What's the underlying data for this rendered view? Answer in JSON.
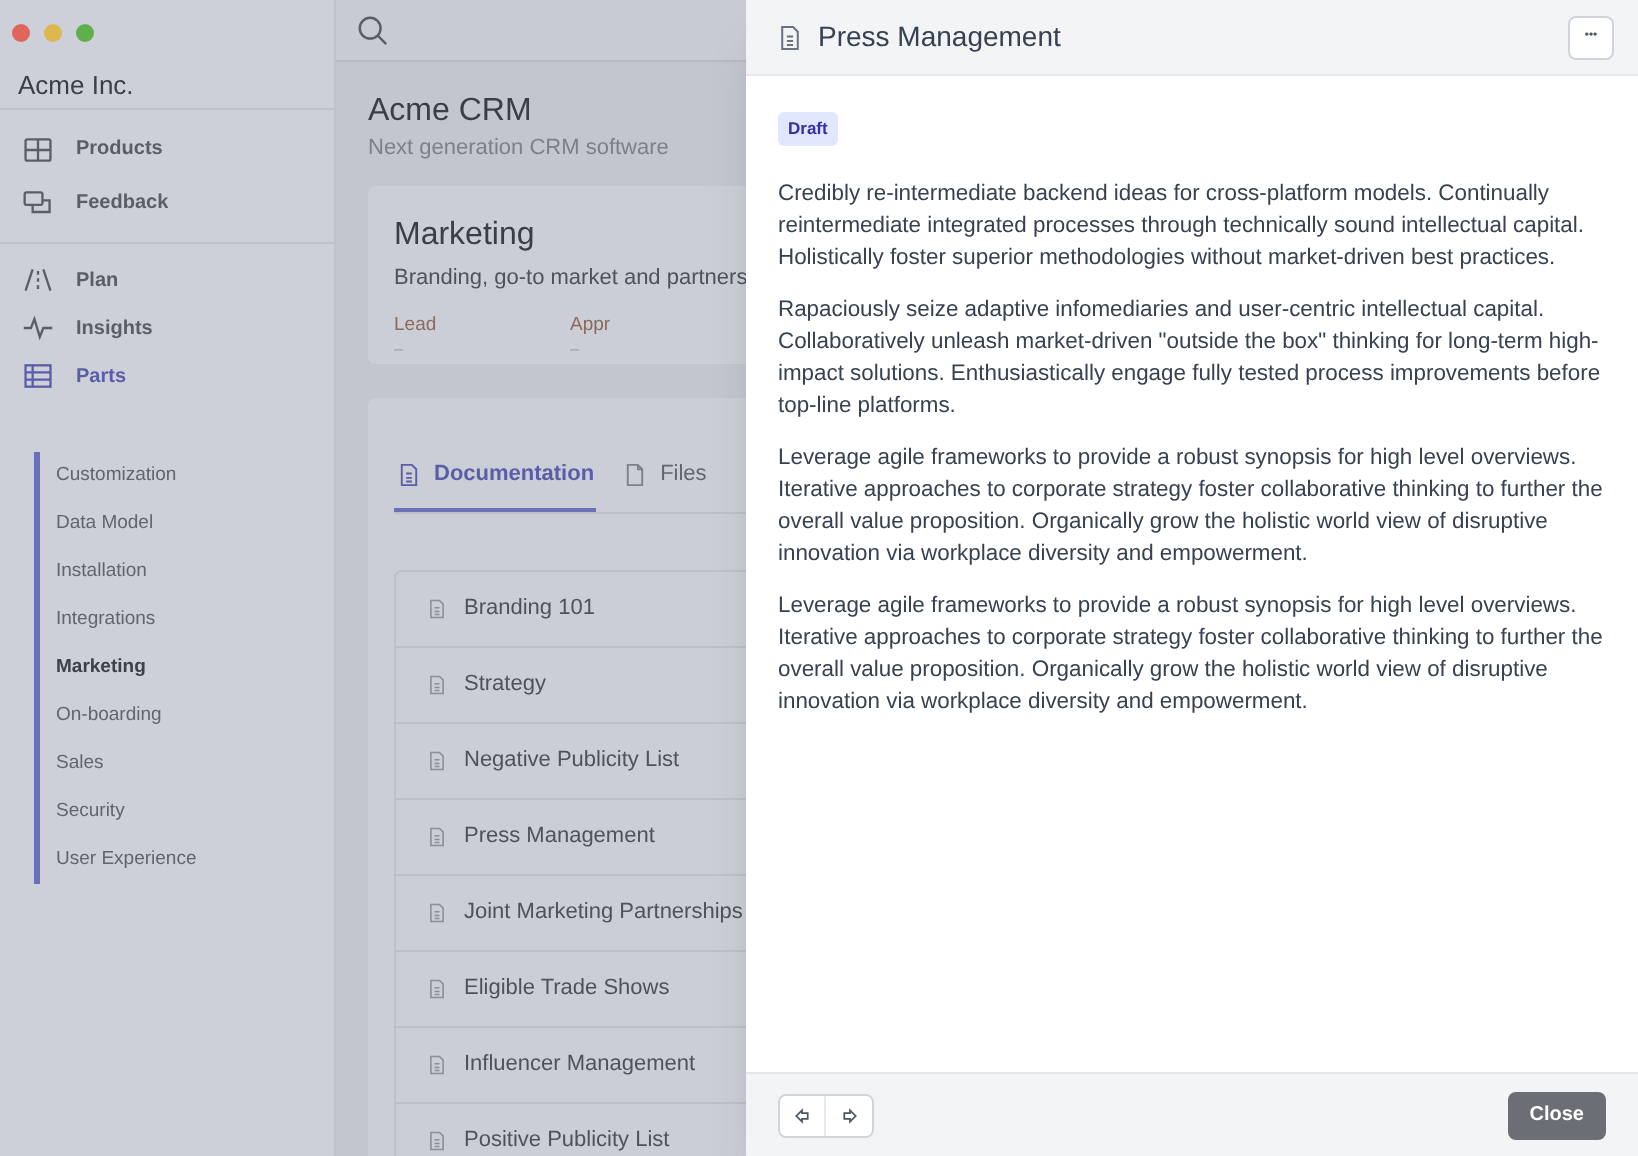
{
  "window": {
    "controls": [
      {
        "color": "#e0655b"
      },
      {
        "color": "#dcb84e"
      },
      {
        "color": "#5eb04b"
      }
    ]
  },
  "sidebar": {
    "org": "Acme Inc.",
    "groups": [
      [
        {
          "label": "Products",
          "selected": false
        },
        {
          "label": "Feedback",
          "selected": false
        }
      ],
      [
        {
          "label": "Plan",
          "selected": false
        },
        {
          "label": "Insights",
          "selected": false
        },
        {
          "label": "Parts",
          "selected": true
        }
      ]
    ],
    "sub_items": [
      {
        "label": "Customization",
        "selected": false
      },
      {
        "label": "Data Model",
        "selected": false
      },
      {
        "label": "Installation",
        "selected": false
      },
      {
        "label": "Integrations",
        "selected": false
      },
      {
        "label": "Marketing",
        "selected": true
      },
      {
        "label": "On-boarding",
        "selected": false
      },
      {
        "label": "Sales",
        "selected": false
      },
      {
        "label": "Security",
        "selected": false
      },
      {
        "label": "User Experience",
        "selected": false
      }
    ]
  },
  "main": {
    "title": "Acme CRM",
    "subtitle": "Next generation CRM software",
    "card": {
      "title": "Marketing",
      "description": "Branding, go-to market and partners",
      "fields": [
        {
          "label": "Lead",
          "value": "–"
        },
        {
          "label": "Appr",
          "value": "–"
        }
      ]
    },
    "tabs": [
      {
        "label": "Documentation",
        "selected": true
      },
      {
        "label": "Files",
        "selected": false
      }
    ],
    "documents": [
      "Branding 101",
      "Strategy",
      "Negative Publicity List",
      "Press Management",
      "Joint Marketing Partnerships",
      "Eligible Trade Shows",
      "Influencer Management",
      "Positive Publicity List"
    ]
  },
  "panel": {
    "title": "Press Management",
    "more": "•••",
    "badge": "Draft",
    "paragraphs": [
      "Credibly re-intermediate backend ideas for cross-platform models. Continually reintermediate integrated processes through technically sound intellectual capital. Holistically foster superior methodologies without market-driven best practices.",
      "Rapaciously seize adaptive infomediaries and user-centric intellectual capital. Collaboratively unleash market-driven \"outside the box\" thinking for long-term high-impact solutions. Enthusiastically engage fully tested process improvements before top-line platforms.",
      "Leverage agile frameworks to provide a robust synopsis for high level overviews. Iterative approaches to corporate strategy foster collaborative thinking to further the overall value proposition. Organically grow the holistic world view of disruptive innovation via workplace diversity and empowerment.",
      "Leverage agile frameworks to provide a robust synopsis for high level overviews. Iterative approaches to corporate strategy foster collaborative thinking to further the overall value proposition. Organically grow the holistic world view of disruptive innovation via workplace diversity and empowerment."
    ],
    "close": "Close"
  }
}
